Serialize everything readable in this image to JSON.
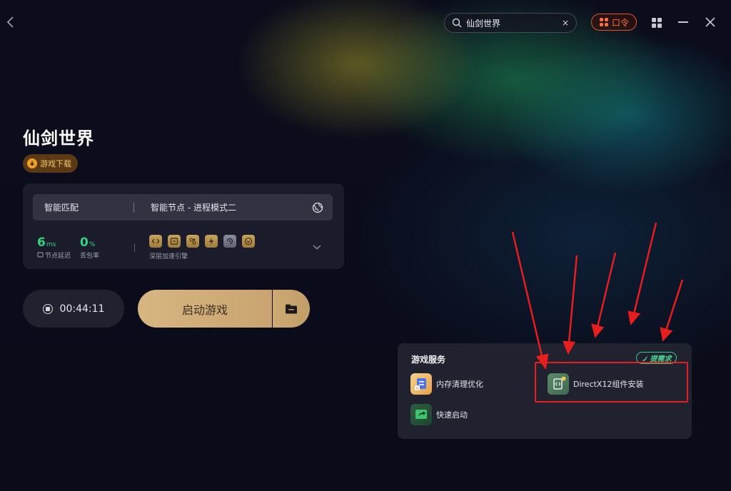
{
  "search": {
    "query": "仙剑世界",
    "clear": "×"
  },
  "header": {
    "code_label": "口令"
  },
  "game": {
    "title": "仙剑世界",
    "download_label": "游戏下载"
  },
  "accel": {
    "match_label": "智能匹配",
    "node_label": "智能节点 - 进程模式二",
    "latency_value": "6",
    "latency_unit": "ms",
    "latency_label": "节点延迟",
    "loss_value": "0",
    "loss_unit": "%",
    "loss_label": "丢包率",
    "engine_label": "深层加速引擎"
  },
  "timer": {
    "value": "00:44:11"
  },
  "launch": {
    "label": "启动游戏"
  },
  "services": {
    "title": "游戏服务",
    "request_label": "提需求",
    "items": [
      {
        "label": "内存清理优化",
        "icon": "memory-clean-icon"
      },
      {
        "label": "DirectX12组件安装",
        "icon": "directx-install-icon"
      },
      {
        "label": "快速启动",
        "icon": "quick-start-icon"
      }
    ]
  },
  "colors": {
    "accent_orange": "#e0552d",
    "accent_green": "#35d381",
    "launch_gold": "#d7b681",
    "highlight_red": "#e61e1e"
  }
}
